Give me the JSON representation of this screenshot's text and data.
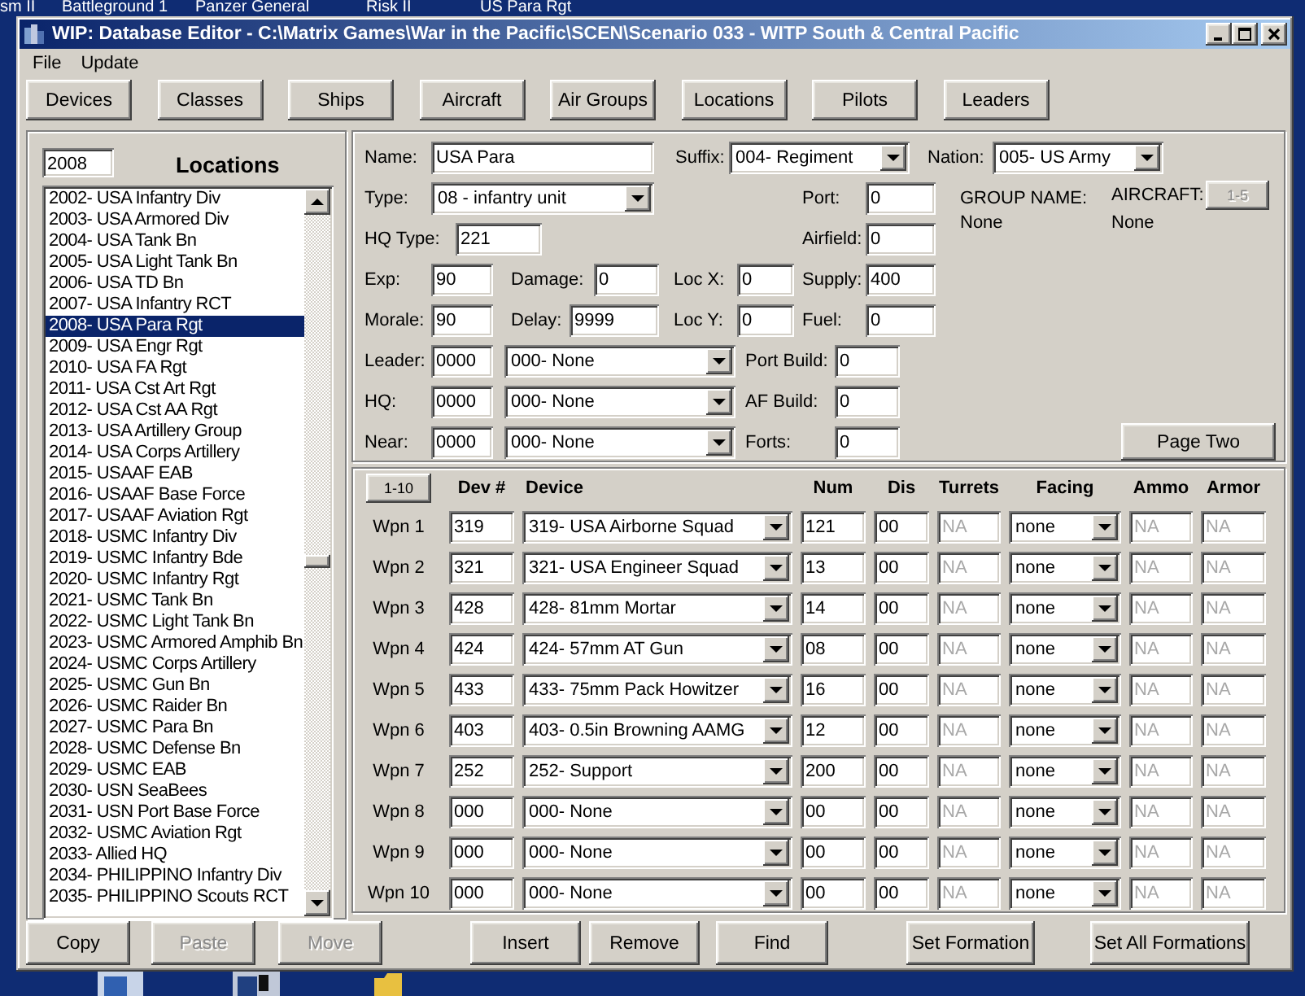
{
  "desktop": {
    "icon_labels": [
      "sm II",
      "Battleground 1",
      "Panzer General",
      "Risk II",
      "US Para Rgt"
    ]
  },
  "window": {
    "title": "WIP: Database Editor - C:\\Matrix Games\\War in the Pacific\\SCEN\\Scenario 033 - WITP South & Central Pacific"
  },
  "menu": [
    "File",
    "Update"
  ],
  "toolbar": [
    "Devices",
    "Classes",
    "Ships",
    "Aircraft",
    "Air Groups",
    "Locations",
    "Pilots",
    "Leaders"
  ],
  "locations": {
    "search": "2008",
    "title": "Locations",
    "items": [
      {
        "label": "2002- USA Infantry Div",
        "selected": false
      },
      {
        "label": "2003- USA Armored  Div",
        "selected": false
      },
      {
        "label": "2004- USA Tank Bn",
        "selected": false
      },
      {
        "label": "2005- USA Light Tank Bn",
        "selected": false
      },
      {
        "label": "2006- USA TD Bn",
        "selected": false
      },
      {
        "label": "2007- USA Infantry RCT",
        "selected": false
      },
      {
        "label": "2008- USA Para Rgt",
        "selected": true
      },
      {
        "label": "2009- USA Engr Rgt",
        "selected": false
      },
      {
        "label": "2010- USA FA Rgt",
        "selected": false
      },
      {
        "label": "2011- USA Cst Art Rgt",
        "selected": false
      },
      {
        "label": "2012- USA Cst AA Rgt",
        "selected": false
      },
      {
        "label": "2013- USA Artillery Group",
        "selected": false
      },
      {
        "label": "2014- USA Corps Artillery",
        "selected": false
      },
      {
        "label": "2015- USAAF EAB",
        "selected": false
      },
      {
        "label": "2016- USAAF Base Force",
        "selected": false
      },
      {
        "label": "2017- USAAF Aviation Rgt",
        "selected": false
      },
      {
        "label": "2018- USMC Infantry Div",
        "selected": false
      },
      {
        "label": "2019- USMC Infantry Bde",
        "selected": false
      },
      {
        "label": "2020- USMC Infantry Rgt",
        "selected": false
      },
      {
        "label": "2021- USMC Tank Bn",
        "selected": false
      },
      {
        "label": "2022- USMC Light Tank Bn",
        "selected": false
      },
      {
        "label": "2023- USMC Armored Amphib Bn",
        "selected": false
      },
      {
        "label": "2024- USMC Corps Artillery",
        "selected": false
      },
      {
        "label": "2025- USMC Gun Bn",
        "selected": false
      },
      {
        "label": "2026- USMC Raider Bn",
        "selected": false
      },
      {
        "label": "2027- USMC Para Bn",
        "selected": false
      },
      {
        "label": "2028- USMC Defense Bn",
        "selected": false
      },
      {
        "label": "2029- USMC EAB",
        "selected": false
      },
      {
        "label": "2030- USN SeaBees",
        "selected": false
      },
      {
        "label": "2031- USN Port Base Force",
        "selected": false
      },
      {
        "label": "2032- USMC Aviation Rgt",
        "selected": false
      },
      {
        "label": "2033- Allied HQ",
        "selected": false
      },
      {
        "label": "2034- PHILIPPINO Infantry Div",
        "selected": false
      },
      {
        "label": "2035- PHILIPPINO Scouts RCT",
        "selected": false
      }
    ]
  },
  "unit_form": {
    "name": {
      "label": "Name:",
      "value": "USA Para"
    },
    "suffix": {
      "label": "Suffix:",
      "value": "004- Regiment"
    },
    "nation": {
      "label": "Nation:",
      "value": "005- US Army"
    },
    "type": {
      "label": "Type:",
      "value": "08 - infantry unit"
    },
    "port": {
      "label": "Port:",
      "value": "0"
    },
    "hq_type": {
      "label": "HQ Type:",
      "value": "221"
    },
    "airfield": {
      "label": "Airfield:",
      "value": "0"
    },
    "exp": {
      "label": "Exp:",
      "value": "90"
    },
    "damage": {
      "label": "Damage:",
      "value": "0"
    },
    "loc_x": {
      "label": "Loc X:",
      "value": "0"
    },
    "supply": {
      "label": "Supply:",
      "value": "400"
    },
    "morale": {
      "label": "Morale:",
      "value": "90"
    },
    "delay": {
      "label": "Delay:",
      "value": "9999"
    },
    "loc_y": {
      "label": "Loc Y:",
      "value": "0"
    },
    "fuel": {
      "label": "Fuel:",
      "value": "0"
    },
    "leader": {
      "label": "Leader:",
      "code": "0000",
      "value": "000- None"
    },
    "hq": {
      "label": "HQ:",
      "code": "0000",
      "value": "000- None"
    },
    "near": {
      "label": "Near:",
      "code": "0000",
      "value": "000- None"
    },
    "port_build": {
      "label": "Port Build:",
      "value": "0"
    },
    "af_build": {
      "label": "AF Build:",
      "value": "0"
    },
    "forts": {
      "label": "Forts:",
      "value": "0"
    },
    "group_name": {
      "label": "GROUP NAME:",
      "value": "None"
    },
    "aircraft": {
      "label": "AIRCRAFT:",
      "value": "None",
      "button": {
        "label": "1-5",
        "disabled": true
      }
    },
    "page_two": {
      "label": "Page Two"
    }
  },
  "weapons": {
    "page_button": "1-10",
    "columns": [
      {
        "label": "Dev #",
        "kind": "text",
        "disabled": false
      },
      {
        "label": "Device",
        "kind": "select",
        "disabled": false
      },
      {
        "label": "Num",
        "kind": "text",
        "disabled": false
      },
      {
        "label": "Dis",
        "kind": "text",
        "disabled": false
      },
      {
        "label": "Turrets",
        "kind": "text",
        "disabled": true
      },
      {
        "label": "Facing",
        "kind": "select",
        "disabled": false
      },
      {
        "label": "Ammo",
        "kind": "text",
        "disabled": true
      },
      {
        "label": "Armor",
        "kind": "text",
        "disabled": true
      }
    ],
    "rows": [
      {
        "label": "Wpn 1",
        "cells": [
          "319",
          "319- USA Airborne Squad",
          "121",
          "00",
          "NA",
          "none",
          "NA",
          "NA"
        ]
      },
      {
        "label": "Wpn 2",
        "cells": [
          "321",
          "321- USA Engineer Squad",
          "13",
          "00",
          "NA",
          "none",
          "NA",
          "NA"
        ]
      },
      {
        "label": "Wpn 3",
        "cells": [
          "428",
          "428- 81mm Mortar",
          "14",
          "00",
          "NA",
          "none",
          "NA",
          "NA"
        ]
      },
      {
        "label": "Wpn 4",
        "cells": [
          "424",
          "424- 57mm AT Gun",
          "08",
          "00",
          "NA",
          "none",
          "NA",
          "NA"
        ]
      },
      {
        "label": "Wpn 5",
        "cells": [
          "433",
          "433- 75mm Pack Howitzer",
          "16",
          "00",
          "NA",
          "none",
          "NA",
          "NA"
        ]
      },
      {
        "label": "Wpn 6",
        "cells": [
          "403",
          "403- 0.5in Browning AAMG",
          "12",
          "00",
          "NA",
          "none",
          "NA",
          "NA"
        ]
      },
      {
        "label": "Wpn 7",
        "cells": [
          "252",
          "252- Support",
          "200",
          "00",
          "NA",
          "none",
          "NA",
          "NA"
        ]
      },
      {
        "label": "Wpn 8",
        "cells": [
          "000",
          "000- None",
          "00",
          "00",
          "NA",
          "none",
          "NA",
          "NA"
        ]
      },
      {
        "label": "Wpn 9",
        "cells": [
          "000",
          "000- None",
          "00",
          "00",
          "NA",
          "none",
          "NA",
          "NA"
        ]
      },
      {
        "label": "Wpn 10",
        "cells": [
          "000",
          "000- None",
          "00",
          "00",
          "NA",
          "none",
          "NA",
          "NA"
        ]
      }
    ]
  },
  "actions": [
    {
      "label": "Copy",
      "disabled": false
    },
    {
      "label": "Paste",
      "disabled": true
    },
    {
      "label": "Move",
      "disabled": true
    },
    {
      "label": "Insert",
      "disabled": false
    },
    {
      "label": "Remove",
      "disabled": false
    },
    {
      "label": "Find",
      "disabled": false
    },
    {
      "label": "Set Formation",
      "disabled": false
    },
    {
      "label": "Set All Formations",
      "disabled": false
    }
  ]
}
